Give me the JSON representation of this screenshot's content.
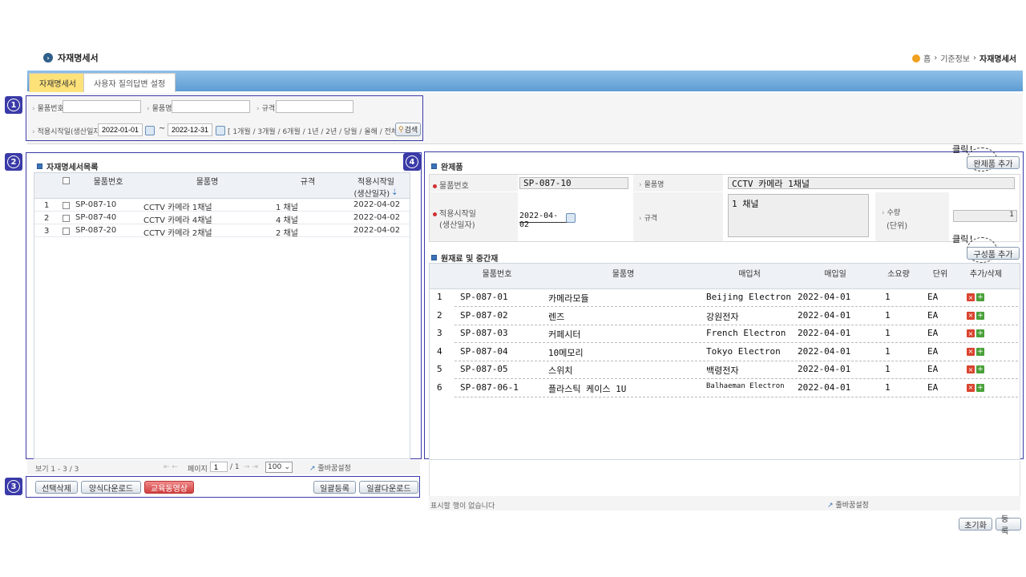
{
  "page": {
    "title": "자재명세서",
    "breadcrumb": [
      "홈",
      "기준정보",
      "자재명세서"
    ]
  },
  "tabs": [
    {
      "label": "자재명세서",
      "active": true
    },
    {
      "label": "사용자 질의답변 설정",
      "active": false
    }
  ],
  "search": {
    "item_no_label": "물품번호",
    "item_name_label": "물품명",
    "spec_label": "규격",
    "date_label": "적용시작일(생산일자)",
    "date_from": "2022-01-01",
    "date_sep": "~",
    "date_to": "2022-12-31",
    "quick_ranges": "[ 1개월 / 3개월 / 6개월 / 1년 / 2년 / 당월 / 올해 / 전체 ]",
    "search_button": "검색"
  },
  "markers": [
    "1",
    "2",
    "3",
    "4"
  ],
  "bom_list": {
    "title": "자재명세서목록",
    "columns": [
      "물품번호",
      "물품명",
      "규격",
      "적용시작일",
      "(생산일자)"
    ],
    "rows": [
      {
        "no": "1",
        "item_no": "SP-087-10",
        "name": "CCTV 카메라 1채널",
        "spec": "1 채널",
        "date": "2022-04-02"
      },
      {
        "no": "2",
        "item_no": "SP-087-40",
        "name": "CCTV 카메라 4채널",
        "spec": "4 채널",
        "date": "2022-04-02"
      },
      {
        "no": "3",
        "item_no": "SP-087-20",
        "name": "CCTV 카메라 2채널",
        "spec": "2 채널",
        "date": "2022-04-02"
      }
    ],
    "footer_count": "보기 1 - 3 / 3",
    "page_label": "페이지",
    "page_current": "1",
    "page_total": "/ 1",
    "page_size": "100",
    "column_settings": "줄바꿈설정"
  },
  "actions": {
    "delete_selected": "선택삭제",
    "download_form": "양식다운로드",
    "training_video": "교육동영상",
    "bulk_register": "일괄등록",
    "bulk_download": "일괄다운로드"
  },
  "product": {
    "title": "완제품",
    "add_button": "완제품 추가",
    "click_note": "클릭!",
    "item_no_label": "물품번호",
    "item_no": "SP-087-10",
    "item_name_label": "물품명",
    "item_name": "CCTV 카메라 1채널",
    "date_label_1": "적용시작일",
    "date_label_2": "(생산일자)",
    "date_value": "2022-04-02",
    "spec_label": "규격",
    "spec_value": "1 채널",
    "qty_label_1": "수량",
    "qty_label_2": "(단위)",
    "qty_value": "1"
  },
  "materials": {
    "title": "원재료 및 중간재",
    "add_button": "구성품 추가",
    "click_note": "클릭!",
    "columns": [
      "물품번호",
      "물품명",
      "매입처",
      "매입일",
      "소요량",
      "단위",
      "추가/삭제"
    ],
    "rows": [
      {
        "no": "1",
        "item_no": "SP-087-01",
        "name": "카메라모듈",
        "vendor": "Beijing Electron",
        "date": "2022-04-01",
        "qty": "1",
        "unit": "EA"
      },
      {
        "no": "2",
        "item_no": "SP-087-02",
        "name": "렌즈",
        "vendor": "강원전자",
        "date": "2022-04-01",
        "qty": "1",
        "unit": "EA"
      },
      {
        "no": "3",
        "item_no": "SP-087-03",
        "name": "커페시터",
        "vendor": "French Electron",
        "date": "2022-04-01",
        "qty": "1",
        "unit": "EA"
      },
      {
        "no": "4",
        "item_no": "SP-087-04",
        "name": "10메모리",
        "vendor": "Tokyo Electron",
        "date": "2022-04-01",
        "qty": "1",
        "unit": "EA"
      },
      {
        "no": "5",
        "item_no": "SP-087-05",
        "name": "스위치",
        "vendor": "백령전자",
        "date": "2022-04-01",
        "qty": "1",
        "unit": "EA"
      },
      {
        "no": "6",
        "item_no": "SP-087-06-1",
        "name": "플라스틱 케이스 1U",
        "vendor": "Balhaeman Electron",
        "date": "2022-04-01",
        "qty": "1",
        "unit": "EA"
      }
    ],
    "empty_text": "표시할 행이 없습니다",
    "column_settings": "줄바꿈설정"
  },
  "bottom": {
    "reset": "초기화",
    "register": "등록"
  }
}
